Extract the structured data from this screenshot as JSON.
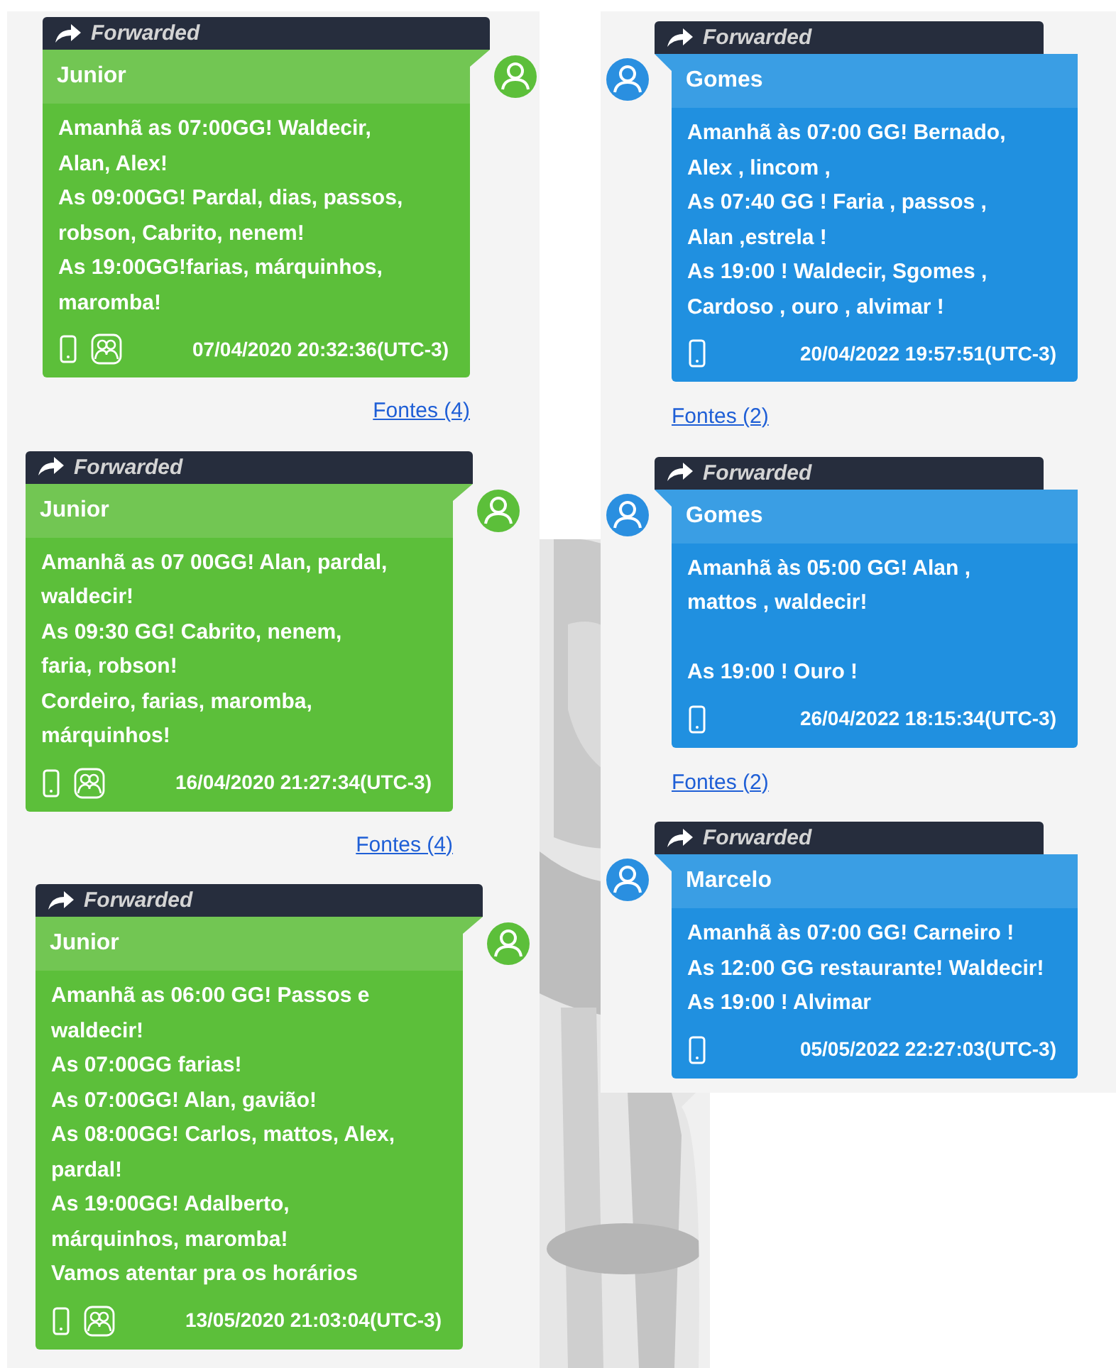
{
  "columns": [
    {
      "kind": "left",
      "messages": [
        {
          "forwarded": "Forwarded",
          "sender": "Junior",
          "paragraphs": [
            [
              "Amanhã as 07:00GG! Waldecir,",
              "Alan, Alex!",
              "As 09:00GG! Pardal, dias, passos,",
              "robson, Cabrito, nenem!",
              "As 19:00GG!farias, márquinhos,",
              "maromba!"
            ]
          ],
          "group": true,
          "timestamp": "07/04/2020 20:32:36(UTC-3)",
          "sources": "Fontes (4)"
        },
        {
          "forwarded": "Forwarded",
          "sender": "Junior",
          "paragraphs": [
            [
              "Amanhã as 07 00GG! Alan, pardal,",
              "waldecir!",
              "As 09:30 GG! Cabrito, nenem,",
              "faria, robson!",
              "Cordeiro, farias, maromba,",
              "márquinhos!"
            ]
          ],
          "group": true,
          "timestamp": "16/04/2020 21:27:34(UTC-3)",
          "sources": "Fontes (4)"
        },
        {
          "forwarded": "Forwarded",
          "sender": "Junior",
          "paragraphs": [
            [
              "Amanhã as 06:00 GG! Passos e",
              "waldecir!",
              "As 07:00GG farias!",
              "As 07:00GG! Alan, gavião!",
              "As 08:00GG! Carlos, mattos, Alex,",
              "pardal!",
              "As 19:00GG! Adalberto,",
              "márquinhos, maromba!",
              "Vamos atentar pra os horários"
            ]
          ],
          "group": true,
          "timestamp": "13/05/2020 21:03:04(UTC-3)"
        }
      ]
    },
    {
      "kind": "right",
      "messages": [
        {
          "forwarded": "Forwarded",
          "sender": "Gomes",
          "paragraphs": [
            [
              "Amanhã às 07:00 GG! Bernado,",
              "Alex , lincom ,",
              "As 07:40 GG ! Faria , passos ,",
              "Alan ,estrela !",
              "As 19:00 ! Waldecir, Sgomes ,",
              "Cardoso , ouro , alvimar !"
            ]
          ],
          "group": false,
          "timestamp": "20/04/2022 19:57:51(UTC-3)",
          "sources": "Fontes (2)"
        },
        {
          "forwarded": "Forwarded",
          "sender": "Gomes",
          "paragraphs": [
            [
              "Amanhã às 05:00 GG! Alan ,",
              "mattos , waldecir!"
            ],
            [
              "As 19:00 ! Ouro !"
            ]
          ],
          "group": false,
          "timestamp": "26/04/2022 18:15:34(UTC-3)",
          "sources": "Fontes (2)"
        },
        {
          "forwarded": "Forwarded",
          "sender": "Marcelo",
          "paragraphs": [
            [
              "Amanhã às 07:00 GG! Carneiro !",
              "As 12:00 GG restaurante! Waldecir!",
              "As 19:00 ! Alvimar"
            ]
          ],
          "group": false,
          "timestamp": "05/05/2022 22:27:03(UTC-3)"
        }
      ]
    }
  ]
}
